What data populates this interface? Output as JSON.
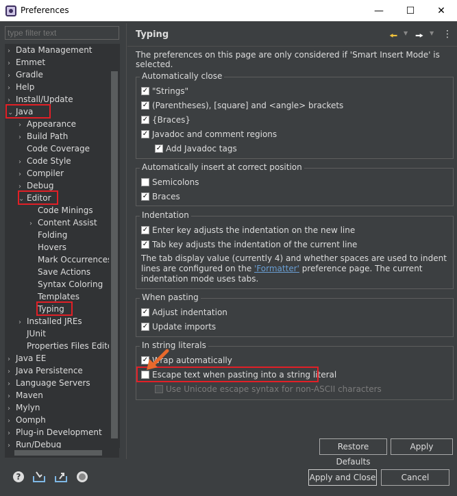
{
  "window": {
    "title": "Preferences"
  },
  "filter": {
    "placeholder": "type filter text"
  },
  "tree": [
    {
      "label": "Data Management",
      "arrow": "›",
      "indent": 0
    },
    {
      "label": "Emmet",
      "arrow": "›",
      "indent": 0
    },
    {
      "label": "Gradle",
      "arrow": "›",
      "indent": 0
    },
    {
      "label": "Help",
      "arrow": "›",
      "indent": 0
    },
    {
      "label": "Install/Update",
      "arrow": "›",
      "indent": 0
    },
    {
      "label": "Java",
      "arrow": "⌄",
      "indent": 0
    },
    {
      "label": "Appearance",
      "arrow": "›",
      "indent": 1
    },
    {
      "label": "Build Path",
      "arrow": "›",
      "indent": 1
    },
    {
      "label": "Code Coverage",
      "arrow": "",
      "indent": 1
    },
    {
      "label": "Code Style",
      "arrow": "›",
      "indent": 1
    },
    {
      "label": "Compiler",
      "arrow": "›",
      "indent": 1
    },
    {
      "label": "Debug",
      "arrow": "›",
      "indent": 1
    },
    {
      "label": "Editor",
      "arrow": "⌄",
      "indent": 1
    },
    {
      "label": "Code Minings",
      "arrow": "",
      "indent": 2
    },
    {
      "label": "Content Assist",
      "arrow": "›",
      "indent": 2
    },
    {
      "label": "Folding",
      "arrow": "",
      "indent": 2
    },
    {
      "label": "Hovers",
      "arrow": "",
      "indent": 2
    },
    {
      "label": "Mark Occurrences",
      "arrow": "",
      "indent": 2
    },
    {
      "label": "Save Actions",
      "arrow": "",
      "indent": 2
    },
    {
      "label": "Syntax Coloring",
      "arrow": "",
      "indent": 2
    },
    {
      "label": "Templates",
      "arrow": "",
      "indent": 2
    },
    {
      "label": "Typing",
      "arrow": "",
      "indent": 2
    },
    {
      "label": "Installed JREs",
      "arrow": "›",
      "indent": 1
    },
    {
      "label": "JUnit",
      "arrow": "",
      "indent": 1
    },
    {
      "label": "Properties Files Editor",
      "arrow": "",
      "indent": 1
    },
    {
      "label": "Java EE",
      "arrow": "›",
      "indent": 0
    },
    {
      "label": "Java Persistence",
      "arrow": "›",
      "indent": 0
    },
    {
      "label": "Language Servers",
      "arrow": "›",
      "indent": 0
    },
    {
      "label": "Maven",
      "arrow": "›",
      "indent": 0
    },
    {
      "label": "Mylyn",
      "arrow": "›",
      "indent": 0
    },
    {
      "label": "Oomph",
      "arrow": "›",
      "indent": 0
    },
    {
      "label": "Plug-in Development",
      "arrow": "›",
      "indent": 0
    },
    {
      "label": "Run/Debug",
      "arrow": "›",
      "indent": 0
    }
  ],
  "page": {
    "title": "Typing",
    "description": "The preferences on this page are only considered if 'Smart Insert Mode' is selected."
  },
  "groups": {
    "auto_close": {
      "legend": "Automatically close",
      "items": [
        {
          "label": "\"Strings\"",
          "checked": true
        },
        {
          "label": "(Parentheses), [square] and <angle> brackets",
          "checked": true
        },
        {
          "label": "{Braces}",
          "checked": true
        },
        {
          "label": "Javadoc and comment regions",
          "checked": true
        },
        {
          "label": "Add Javadoc tags",
          "checked": true
        }
      ]
    },
    "auto_insert": {
      "legend": "Automatically insert at correct position",
      "items": [
        {
          "label": "Semicolons",
          "checked": false
        },
        {
          "label": "Braces",
          "checked": true
        }
      ]
    },
    "indentation": {
      "legend": "Indentation",
      "items": [
        {
          "label": "Enter key adjusts the indentation on the new line",
          "checked": true
        },
        {
          "label": "Tab key adjusts the indentation of the current line",
          "checked": true
        }
      ],
      "para_before": "The tab display value (currently 4) and whether spaces are used to indent lines are configured on the ",
      "para_link": "'Formatter'",
      "para_after": " preference page. The current indentation mode uses tabs."
    },
    "pasting": {
      "legend": "When pasting",
      "items": [
        {
          "label": "Adjust indentation",
          "checked": true
        },
        {
          "label": "Update imports",
          "checked": true
        }
      ]
    },
    "string_literals": {
      "legend": "In string literals",
      "items": [
        {
          "label": "Wrap automatically",
          "checked": true
        },
        {
          "label": "Escape text when pasting into a string literal",
          "checked": false
        },
        {
          "label": "Use Unicode escape syntax for non-ASCII characters",
          "checked": false,
          "disabled": true
        }
      ]
    }
  },
  "buttons": {
    "restore_defaults": "Restore Defaults",
    "apply": "Apply",
    "apply_and_close": "Apply and Close",
    "cancel": "Cancel"
  },
  "icons": {
    "help": "help-icon",
    "import": "import-icon",
    "export": "export-icon",
    "oomph": "oomph-record-icon",
    "back": "back-arrow-icon",
    "forward": "forward-arrow-icon",
    "menu": "view-menu-icon"
  },
  "colors": {
    "highlight": "#e21f26",
    "annotation_arrow": "#e8692c",
    "link": "#6a9fd4"
  }
}
